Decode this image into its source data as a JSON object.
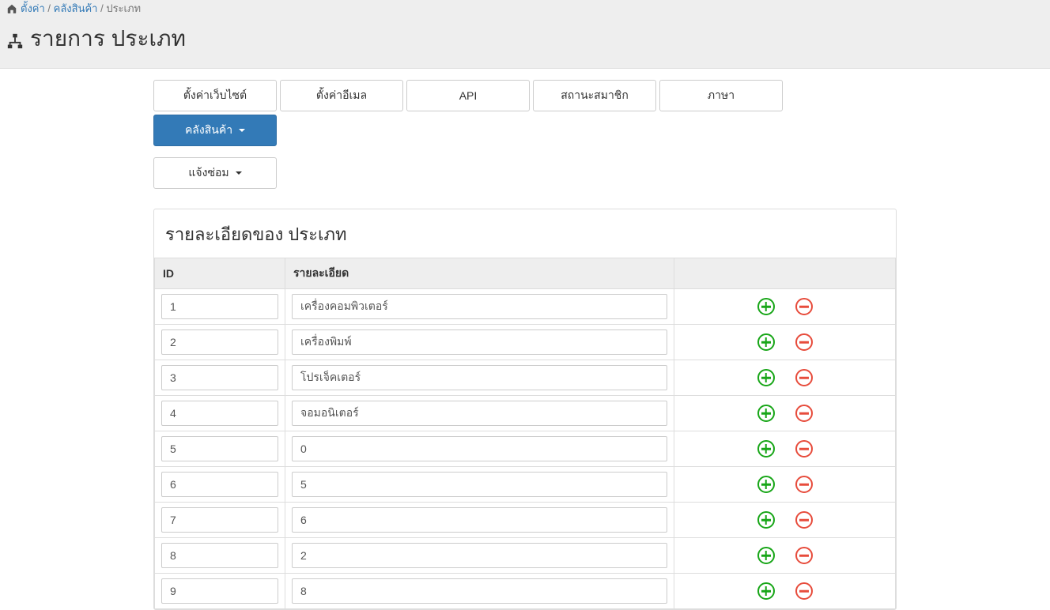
{
  "breadcrumb": {
    "items": [
      {
        "label": "ตั้งค่า",
        "link": true
      },
      {
        "label": "คลังสินค้า",
        "link": true
      },
      {
        "label": "ประเภท",
        "link": false
      }
    ]
  },
  "page_title": "รายการ ประเภท",
  "tabs": {
    "row1": [
      {
        "label": "ตั้งค่าเว็บไซต์",
        "active": false,
        "caret": false
      },
      {
        "label": "ตั้งค่าอีเมล",
        "active": false,
        "caret": false
      },
      {
        "label": "API",
        "active": false,
        "caret": false
      },
      {
        "label": "สถานะสมาชิก",
        "active": false,
        "caret": false
      },
      {
        "label": "ภาษา",
        "active": false,
        "caret": false
      },
      {
        "label": "คลังสินค้า",
        "active": true,
        "caret": true
      }
    ],
    "row2": [
      {
        "label": "แจ้งซ่อม",
        "active": false,
        "caret": true
      }
    ]
  },
  "panel": {
    "title": "รายละเอียดของ ประเภท",
    "columns": {
      "id": "ID",
      "detail": "รายละเอียด"
    },
    "rows": [
      {
        "id": "1",
        "detail": "เครื่องคอมพิวเตอร์"
      },
      {
        "id": "2",
        "detail": "เครื่องพิมพ์"
      },
      {
        "id": "3",
        "detail": "โปรเจ็คเตอร์"
      },
      {
        "id": "4",
        "detail": "จอมอนิเตอร์"
      },
      {
        "id": "5",
        "detail": "0"
      },
      {
        "id": "6",
        "detail": "5"
      },
      {
        "id": "7",
        "detail": "6"
      },
      {
        "id": "8",
        "detail": "2"
      },
      {
        "id": "9",
        "detail": "8"
      }
    ]
  }
}
